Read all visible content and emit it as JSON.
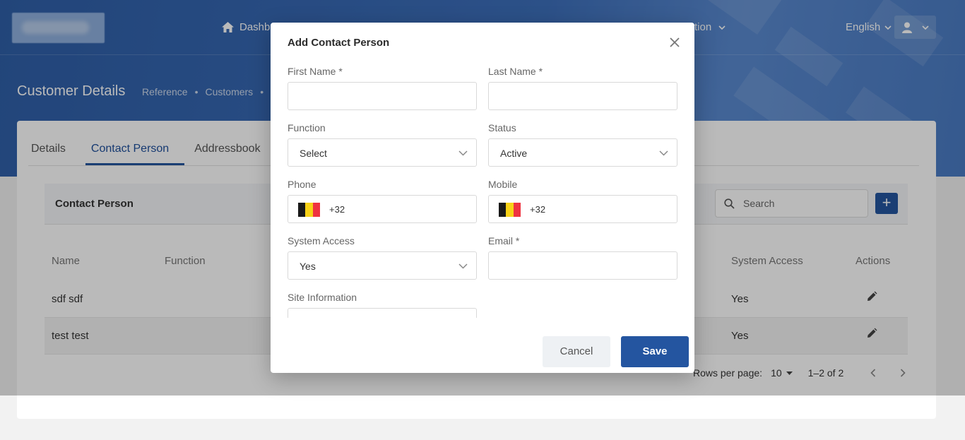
{
  "header": {
    "nav_dashboard": "Dashb",
    "nav_fragment": "tion",
    "language": "English"
  },
  "page": {
    "title": "Customer Details",
    "breadcrumb": [
      "Reference",
      "Customers"
    ]
  },
  "tabs": [
    "Details",
    "Contact Person",
    "Addressbook"
  ],
  "contact_section": {
    "title": "Contact Person",
    "search_placeholder": "Search",
    "add_label": "+",
    "columns": [
      "Name",
      "Function",
      "System Access",
      "Actions"
    ],
    "rows": [
      {
        "name": "sdf sdf",
        "system_access": "Yes"
      },
      {
        "name": "test test",
        "system_access": "Yes"
      }
    ],
    "pagination": {
      "rows_per_page_label": "Rows per page:",
      "rows_per_page": "10",
      "range": "1–2 of 2"
    }
  },
  "modal": {
    "title": "Add Contact Person",
    "first_name_label": "First Name *",
    "last_name_label": "Last Name *",
    "function_label": "Function",
    "function_value": "Select",
    "status_label": "Status",
    "status_value": "Active",
    "phone_label": "Phone",
    "phone_code": "+32",
    "mobile_label": "Mobile",
    "mobile_code": "+32",
    "system_access_label": "System Access",
    "system_access_value": "Yes",
    "email_label": "Email *",
    "site_info_label": "Site Information",
    "cancel_label": "Cancel",
    "save_label": "Save"
  },
  "colors": {
    "primary": "#2455a0",
    "header_bg": "#3d6fbb",
    "flag_black": "#1a1a1a",
    "flag_yellow": "#f7d117",
    "flag_red": "#ef3340"
  }
}
